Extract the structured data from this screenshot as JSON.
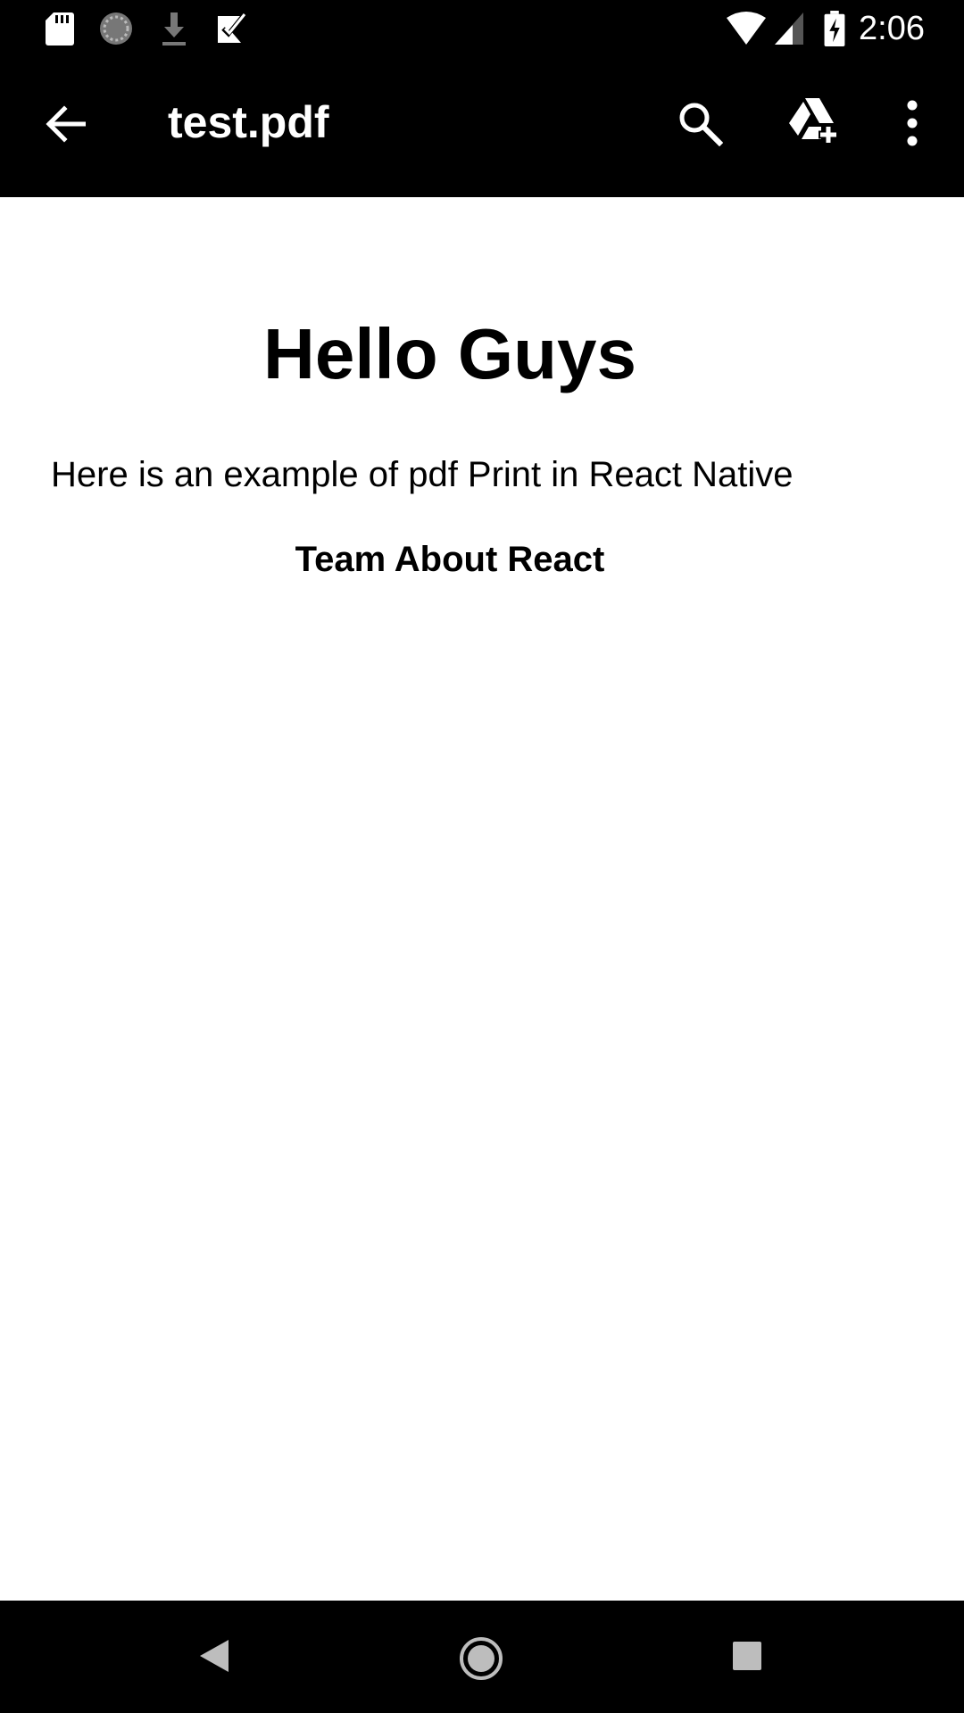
{
  "status_bar": {
    "time": "2:06",
    "left_icons": [
      "sd-card-icon",
      "sync-progress-icon",
      "download-icon",
      "task-check-icon"
    ],
    "right_icons": [
      "wifi-icon",
      "cell-signal-icon",
      "battery-charging-icon"
    ]
  },
  "app_bar": {
    "title": "test.pdf",
    "icons": [
      "back-arrow-icon",
      "search-icon",
      "add-to-drive-icon",
      "more-vert-icon"
    ]
  },
  "document": {
    "heading": "Hello Guys",
    "paragraph": "Here is an example of pdf Print in React Native",
    "signature": "Team About React"
  },
  "nav_bar": {
    "icons": [
      "nav-back-icon",
      "nav-home-icon",
      "nav-recents-icon"
    ]
  },
  "colors": {
    "bar_background": "#000000",
    "page_background": "#ffffff",
    "text": "#000000",
    "bar_icon": "#ffffff"
  }
}
